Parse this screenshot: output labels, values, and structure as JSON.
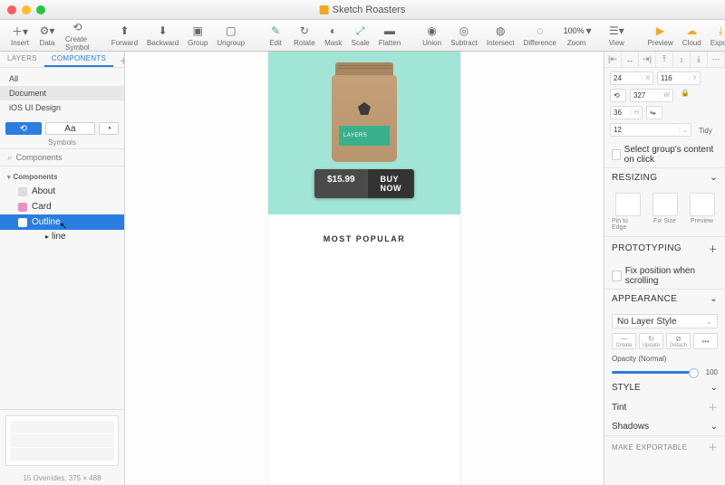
{
  "window": {
    "title": "Sketch Roasters"
  },
  "toolbar": {
    "insert": "Insert",
    "data": "Data",
    "createSymbol": "Create Symbol",
    "forward": "Forward",
    "backward": "Backward",
    "group": "Group",
    "ungroup": "Ungroup",
    "edit": "Edit",
    "rotate": "Rotate",
    "mask": "Mask",
    "scale": "Scale",
    "flatten": "Flatten",
    "union": "Union",
    "subtract": "Subtract",
    "intersect": "Intersect",
    "difference": "Difference",
    "zoom": "Zoom",
    "zoomValue": "100%",
    "view": "View",
    "preview": "Preview",
    "cloud": "Cloud",
    "export": "Export"
  },
  "sidebar": {
    "tabs": {
      "layers": "LAYERS",
      "components": "COMPONENTS"
    },
    "filters": {
      "all": "All",
      "document": "Document",
      "ios": "iOS UI Design"
    },
    "symbolLabel": "Symbols",
    "aa": "Aa",
    "searchPlaceholder": "Components",
    "treeHeader": "Components",
    "items": {
      "about": "About",
      "card": "Card",
      "outline": "Outline",
      "subOutline": "line"
    },
    "pageInfo": "15 Overrides, 375 × 488"
  },
  "artboard": {
    "bagLabel": "LAYERS",
    "price": "$15.99",
    "buy": "BUY NOW",
    "popular": "MOST POPULAR"
  },
  "inspector": {
    "x": "24",
    "xL": "X",
    "y": "116",
    "yL": "Y",
    "w": "327",
    "wL": "W",
    "h": "36",
    "hL": "H",
    "r": "12",
    "rL": "",
    "tidy": "Tidy",
    "selectGroups": "Select group's content on click",
    "resizing": "RESIZING",
    "pinEdge": "Pin to Edge",
    "fixSize": "Fix Size",
    "previewR": "Preview",
    "prototyping": "PROTOTYPING",
    "fixPos": "Fix position when scrolling",
    "appearance": "APPEARANCE",
    "layerStyle": "No Layer Style",
    "create": "Create",
    "update": "Update",
    "detach": "Detach",
    "more": "•••",
    "opacityLabel": "Opacity (Normal)",
    "opacityVal": "100",
    "style": "STYLE",
    "tint": "Tint",
    "shadows": "Shadows",
    "exportable": "MAKE EXPORTABLE"
  }
}
